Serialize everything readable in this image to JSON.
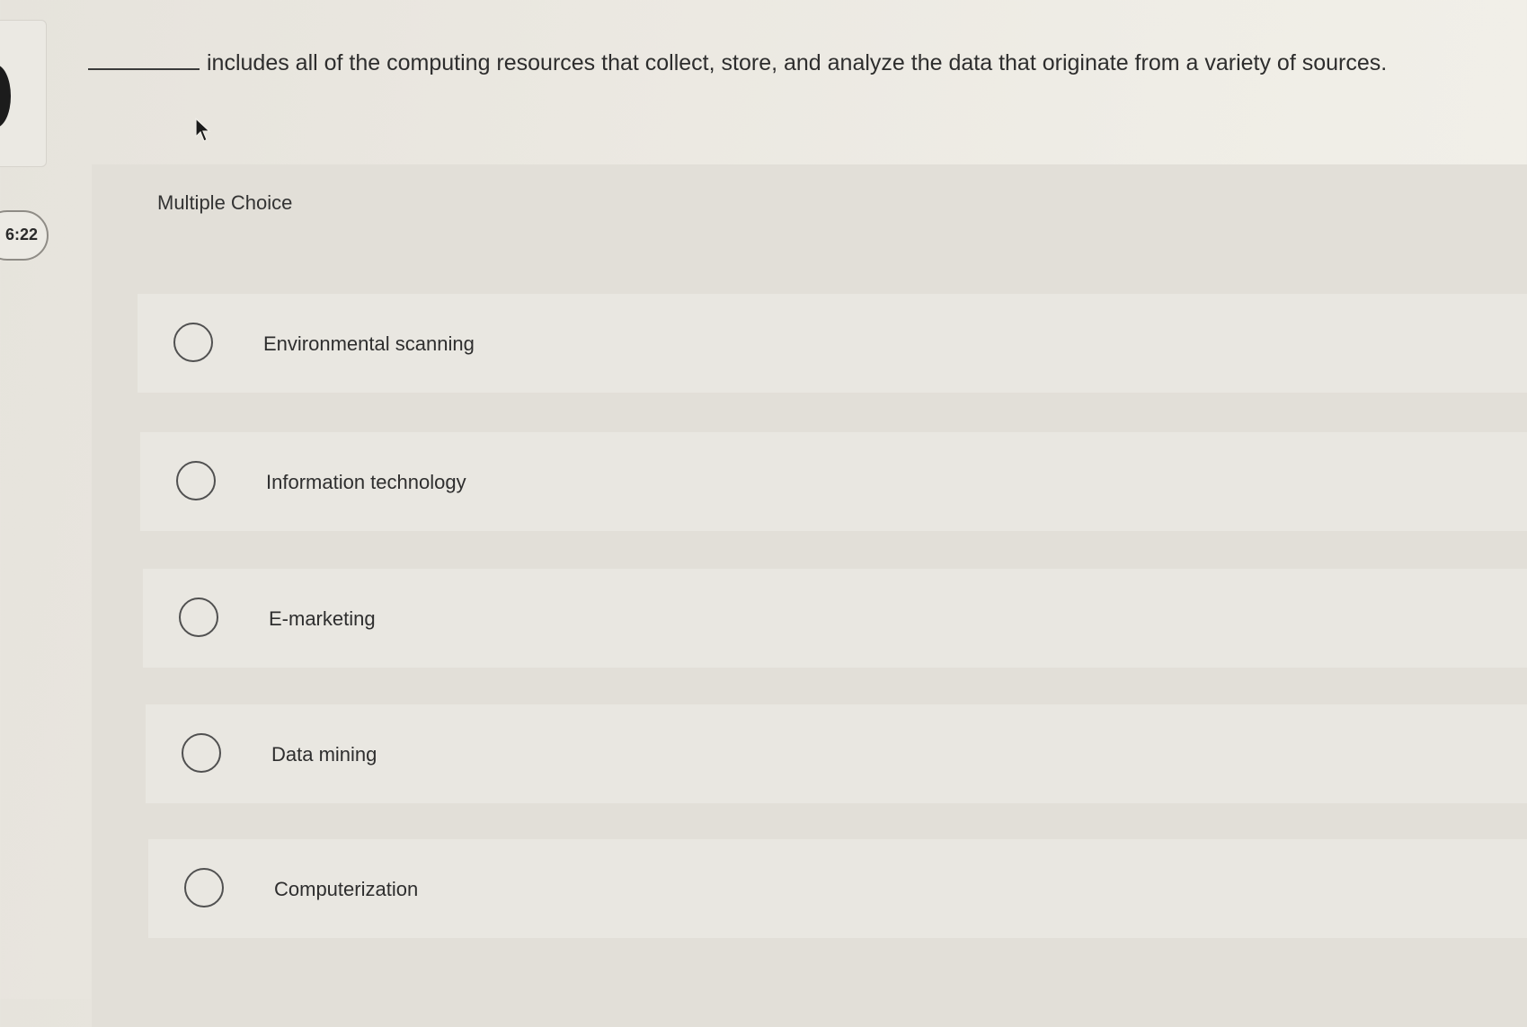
{
  "timer": {
    "text": "6:22"
  },
  "question": {
    "text": "includes all of the computing resources that collect, store, and analyze the data that originate from a variety of sources."
  },
  "panel": {
    "label": "Multiple Choice"
  },
  "options": [
    {
      "label": "Environmental scanning",
      "selected": false
    },
    {
      "label": "Information technology",
      "selected": false
    },
    {
      "label": "E-marketing",
      "selected": false
    },
    {
      "label": "Data mining",
      "selected": false
    },
    {
      "label": "Computerization",
      "selected": false
    }
  ]
}
